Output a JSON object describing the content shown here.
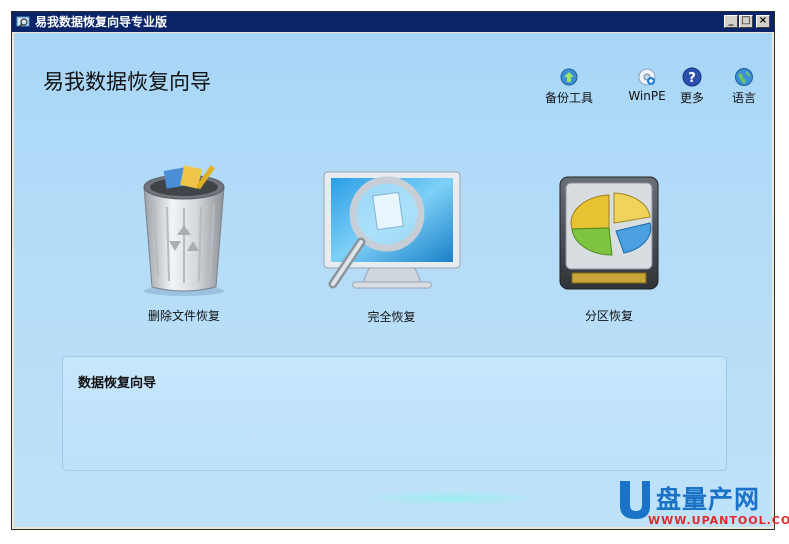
{
  "window": {
    "title": "易我数据恢复向导专业版",
    "min_symbol": "_",
    "max_symbol": "□",
    "close_symbol": "×"
  },
  "header": {
    "app_title": "易我数据恢复向导"
  },
  "toolbar": {
    "items": [
      {
        "label": "备份工具",
        "icon": "backup-icon"
      },
      {
        "label": "WinPE",
        "icon": "winpe-icon"
      },
      {
        "label": "更多",
        "icon": "help-icon"
      },
      {
        "label": "语言",
        "icon": "globe-icon"
      }
    ]
  },
  "features": [
    {
      "label": "删除文件恢复",
      "icon": "trash-bin-icon"
    },
    {
      "label": "完全恢复",
      "icon": "monitor-magnifier-icon"
    },
    {
      "label": "分区恢复",
      "icon": "hard-drive-pie-icon"
    }
  ],
  "info_panel": {
    "title": "数据恢复向导"
  },
  "watermark": {
    "text": "盘量产网",
    "url": "WWW.UPANTOOL.COM"
  },
  "colors": {
    "titlebar": "#0a246a",
    "client_bg": "#b4dcf8",
    "panel_bg": "#c6e6fb",
    "watermark_blue": "#1a73c6",
    "watermark_red": "#e12929"
  }
}
